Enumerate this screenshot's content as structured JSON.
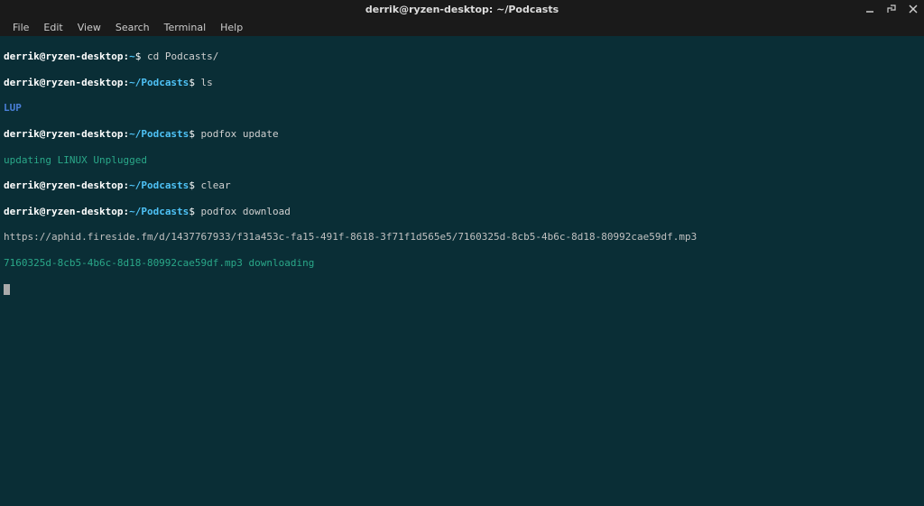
{
  "window": {
    "title": "derrik@ryzen-desktop: ~/Podcasts"
  },
  "menubar": {
    "file": "File",
    "edit": "Edit",
    "view": "View",
    "search": "Search",
    "terminal": "Terminal",
    "help": "Help"
  },
  "colors": {
    "bg": "#0a2e36",
    "titlebar_bg": "#1a1a1a",
    "user_host": "#ffffff",
    "path": "#4fc3f7",
    "cmd": "#d0d0d0",
    "output_blue": "#4a7fd8",
    "output_green": "#2aa889",
    "output_white": "#c0c0c0"
  },
  "lines": [
    {
      "type": "prompt",
      "user_host": "derrik@ryzen-desktop",
      "colon": ":",
      "path": "~",
      "dollar": "$",
      "cmd": " cd Podcasts/"
    },
    {
      "type": "prompt",
      "user_host": "derrik@ryzen-desktop",
      "colon": ":",
      "path": "~/Podcasts",
      "dollar": "$",
      "cmd": " ls"
    },
    {
      "type": "output",
      "class": "output-blue",
      "text": "LUP"
    },
    {
      "type": "prompt",
      "user_host": "derrik@ryzen-desktop",
      "colon": ":",
      "path": "~/Podcasts",
      "dollar": "$",
      "cmd": " podfox update"
    },
    {
      "type": "output",
      "class": "output-green",
      "text": "updating LINUX Unplugged"
    },
    {
      "type": "prompt",
      "user_host": "derrik@ryzen-desktop",
      "colon": ":",
      "path": "~/Podcasts",
      "dollar": "$",
      "cmd": " clear"
    },
    {
      "type": "prompt",
      "user_host": "derrik@ryzen-desktop",
      "colon": ":",
      "path": "~/Podcasts",
      "dollar": "$",
      "cmd": " podfox download"
    },
    {
      "type": "output",
      "class": "output-white",
      "text": "https://aphid.fireside.fm/d/1437767933/f31a453c-fa15-491f-8618-3f71f1d565e5/7160325d-8cb5-4b6c-8d18-80992cae59df.mp3"
    },
    {
      "type": "output",
      "class": "output-green",
      "text": "7160325d-8cb5-4b6c-8d18-80992cae59df.mp3 downloading"
    }
  ]
}
